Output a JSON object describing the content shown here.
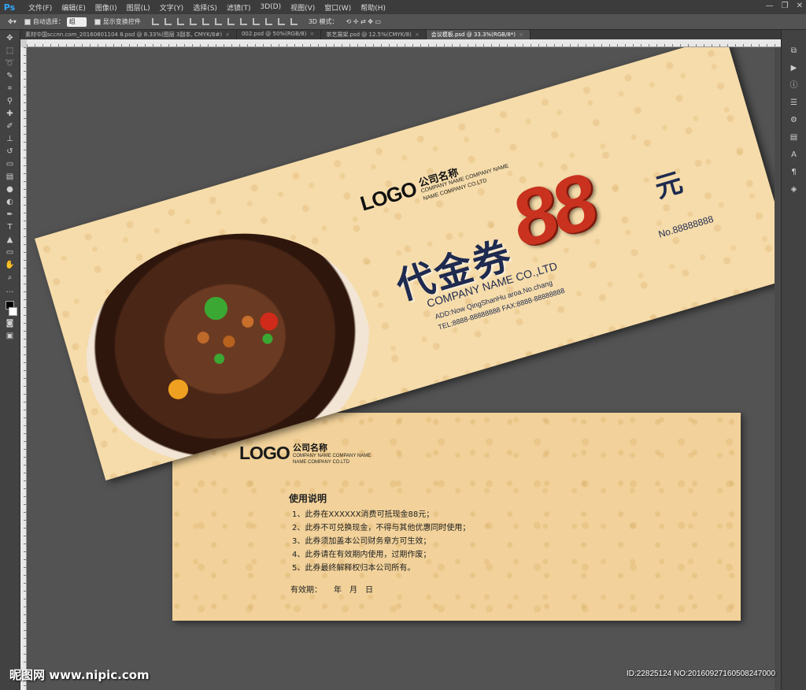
{
  "app": {
    "logo": "Ps",
    "menu": [
      "文件(F)",
      "编辑(E)",
      "图像(I)",
      "图层(L)",
      "文字(Y)",
      "选择(S)",
      "滤镜(T)",
      "3D(D)",
      "视图(V)",
      "窗口(W)",
      "帮助(H)"
    ],
    "window_controls": [
      "—",
      "❐",
      "✕"
    ]
  },
  "options": {
    "auto_select_label": "自动选择：",
    "auto_select_value": "组",
    "show_transform_label": "显示变换控件",
    "mode3d_label": "3D 模式："
  },
  "tabs": [
    {
      "label": "素材中国sccnn.com_20160801104 8.psd @ 8.33%(图层 3副本, CMYK/8#)",
      "active": false
    },
    {
      "label": "002.psd @ 50%(RGB/8)",
      "active": false
    },
    {
      "label": "茶艺展架.psd @ 12.5%(CMYK/8)",
      "active": false
    },
    {
      "label": "会议模板.psd @ 33.3%(RGB/8*)",
      "active": true
    }
  ],
  "front": {
    "logo": "LOGO",
    "company_cn": "公司名称",
    "company_en1": "COMPANY NAME COMPANY NAME",
    "company_en2": "NAME COMPANY CO.LTD",
    "voucher": "代金券",
    "amount": "88",
    "unit": "元",
    "company": "COMPANY NAME CO.,LTD",
    "address": "ADD:Now QingShanHu aroa.No.chang",
    "phone": "TEL:8888-88888888  FAX:8888-88888888",
    "number": "No.88888888"
  },
  "back": {
    "logo": "LOGO",
    "company_cn": "公司名称",
    "company_en1": "COMPANY NAME COMPANY NAME",
    "company_en2": "NAME COMPANY CO.LTD",
    "usage_title": "使用说明",
    "rules": [
      "1、此券在XXXXXX消费可抵现金88元；",
      "2、此券不可兑换现金，不得与其他优惠同时使用；",
      "3、此券须加盖本公司财务章方可生效；",
      "4、此券请在有效期内使用，过期作废；",
      "5、此券最终解释权归本公司所有。"
    ],
    "valid": "有效期：　　年　月　日"
  },
  "watermark": {
    "left": "昵图网 www.nipic.com",
    "right": "ID:22825124 NO:20160927160508247000"
  }
}
